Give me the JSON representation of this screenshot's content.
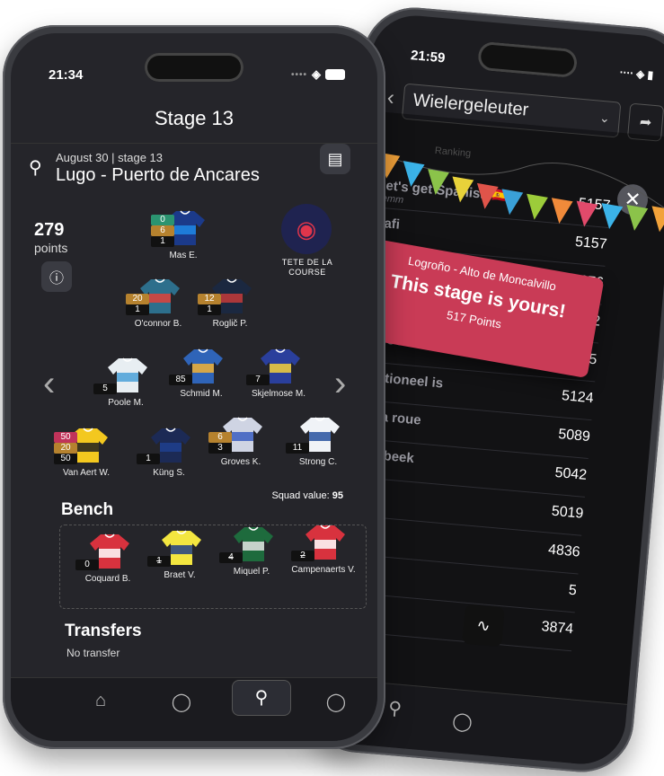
{
  "front": {
    "status": {
      "time": "21:34"
    },
    "title": "Stage 13",
    "stage": {
      "subtitle": "August 30 | stage 13",
      "name": "Lugo - Puerto de Ancares"
    },
    "score": {
      "value": "279",
      "unit": "points"
    },
    "team": {
      "name": "TETE DE LA COURSE",
      "accent": "#e0354b"
    },
    "riders": [
      {
        "name": "Mas E.",
        "badges": [
          "0",
          "6",
          "1"
        ],
        "colors": [
          "#1b3a8a",
          "#1e88e5"
        ]
      },
      {
        "name": "O'connor B.",
        "badges": [
          "20",
          "1"
        ],
        "colors": [
          "#2d6f8c",
          "#e0423a"
        ]
      },
      {
        "name": "Roglič P.",
        "badges": [
          "12",
          "1"
        ],
        "colors": [
          "#1b2840",
          "#c43a3a"
        ]
      },
      {
        "name": "Poole M.",
        "badges": [
          "5"
        ],
        "colors": [
          "#e8eef2",
          "#4aa0d8"
        ]
      },
      {
        "name": "Schmid M.",
        "badges": [
          "85"
        ],
        "colors": [
          "#2f64b8",
          "#f2b134"
        ]
      },
      {
        "name": "Skjelmose M.",
        "badges": [
          "7"
        ],
        "colors": [
          "#2a3f9c",
          "#f5d13b"
        ]
      },
      {
        "name": "Van Aert W.",
        "badges": [
          "50",
          "20",
          "50"
        ],
        "colors": [
          "#f3c81f",
          "#1e1e1e"
        ]
      },
      {
        "name": "Küng S.",
        "badges": [
          "1"
        ],
        "colors": [
          "#1c2a55",
          "#1e3f8f"
        ]
      },
      {
        "name": "Groves K.",
        "badges": [
          "6",
          "3"
        ],
        "colors": [
          "#cfd4e3",
          "#3a5dc0"
        ]
      },
      {
        "name": "Strong C.",
        "badges": [
          "11"
        ],
        "colors": [
          "#f0f3f7",
          "#27519f"
        ]
      }
    ],
    "bench": {
      "title": "Bench",
      "squad_label": "Squad value:",
      "squad_value": "95",
      "riders": [
        {
          "name": "Coquard B.",
          "badge": "0",
          "struck": false,
          "colors": [
            "#d8323e",
            "#ffffff"
          ]
        },
        {
          "name": "Braet V.",
          "badge": "1",
          "struck": true,
          "colors": [
            "#f3e640",
            "#1f3d86"
          ]
        },
        {
          "name": "Miquel P.",
          "badge": "4",
          "struck": true,
          "colors": [
            "#1e6b3d",
            "#e4e4e4"
          ]
        },
        {
          "name": "Campenaerts V.",
          "badge": "2",
          "struck": true,
          "colors": [
            "#d8323e",
            "#ffffff"
          ]
        }
      ]
    },
    "transfers": {
      "title": "Transfers",
      "text": "No transfer"
    }
  },
  "back": {
    "status": {
      "time": "21:59"
    },
    "league": "Wielergeleuter",
    "rank_header": "Ranking",
    "rows": [
      {
        "team": "Let's get Spanish",
        "flag": "🇪🇸",
        "sub": "Temm",
        "score": "5157"
      },
      {
        "team": "Nafi",
        "sub": "",
        "score": "5157"
      },
      {
        "team": "",
        "sub": "",
        "score": "5676"
      },
      {
        "team": "",
        "sub": "",
        "score": "2"
      },
      {
        "team": "e-Ooo",
        "sub": "",
        "score": "5"
      },
      {
        "team": "unctioneel is",
        "sub": "s",
        "score": "5124"
      },
      {
        "team": "de la roue",
        "sub": "",
        "score": "5089"
      },
      {
        "team": "Holsbeek",
        "sub": "eri",
        "score": "5042"
      },
      {
        "team": "ow",
        "sub": "",
        "score": "5019"
      },
      {
        "team": "os",
        "sub": "",
        "score": "4836"
      },
      {
        "team": "",
        "sub": "",
        "score": "5"
      },
      {
        "team": "",
        "sub": "",
        "score": "3874"
      }
    ],
    "banner": {
      "stage": "Logroño - Alto de Moncalvillo",
      "headline": "This stage is yours!",
      "points": "517 Points",
      "color": "#c93b56"
    }
  }
}
